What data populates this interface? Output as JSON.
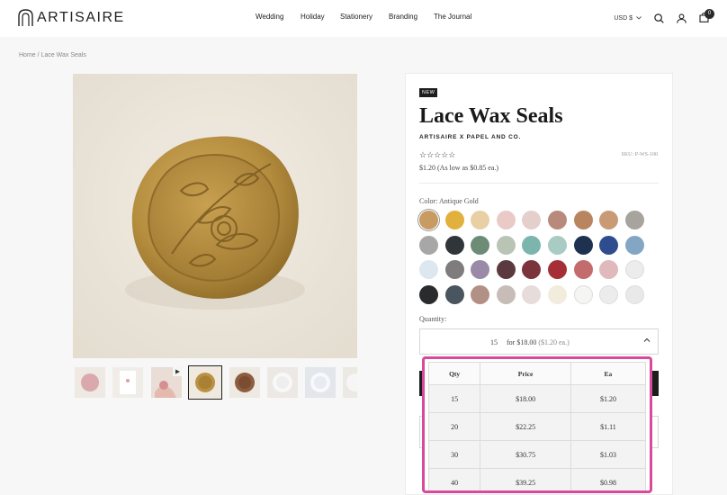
{
  "header": {
    "brand": "ARTISAIRE",
    "nav": [
      "Wedding",
      "Holiday",
      "Stationery",
      "Branding",
      "The Journal"
    ],
    "currency": "USD $",
    "cart_count": "0"
  },
  "breadcrumb": {
    "home": "Home",
    "separator": "/",
    "current": "Lace Wax Seals"
  },
  "product": {
    "badge": "NEW",
    "title": "Lace Wax Seals",
    "vendor": "ARTISAIRE X PAPEL AND CO.",
    "stars": "☆☆☆☆☆",
    "rating": 0,
    "sku": "SKU: P-WS-100",
    "price": "$1.20 (As low as $0.85 ea.)",
    "color_label": "Color:",
    "color_value": "Antique Gold",
    "swatch_colors": [
      [
        "#c79b62",
        "#e2b03d",
        "#e9cfa4",
        "#e9cac6",
        "#e4cfcc",
        "#b88a7b",
        "#b98560",
        "#c99b75",
        "#a7a39d"
      ],
      [
        "#a7a7a7",
        "#30353a",
        "#6c8c76",
        "#b9c4b5",
        "#7bb5ad",
        "#a8cbc3",
        "#1f3151",
        "#2f4c8f",
        "#84a6c5"
      ],
      [
        "#dce7f0",
        "#7e7c7d",
        "#9a8aa7",
        "#5a3a3f",
        "#7b343b",
        "#a52f36",
        "#c46b6d",
        "#e0b9bc",
        "#ececec"
      ],
      [
        "#2a2b2d",
        "#4a5560",
        "#b39085",
        "#c8bcb8",
        "#e6dcda",
        "#f2ecdc",
        "#f5f5f3",
        "#ececec",
        "#e9e9e9"
      ]
    ],
    "quantity_label": "Quantity:",
    "quantity_selected": "15",
    "quantity_selected_price": "for $18.00",
    "quantity_selected_each": "($1.20 ea.)"
  },
  "price_table": {
    "headers": [
      "Qty",
      "Price",
      "Ea"
    ],
    "rows": [
      [
        "15",
        "$18.00",
        "$1.20"
      ],
      [
        "20",
        "$22.25",
        "$1.11"
      ],
      [
        "30",
        "$30.75",
        "$1.03"
      ],
      [
        "40",
        "$39.25",
        "$0.98"
      ]
    ]
  },
  "colors": {
    "accent_highlight": "#d84a9c",
    "wax_gold": "#b18a3c"
  }
}
